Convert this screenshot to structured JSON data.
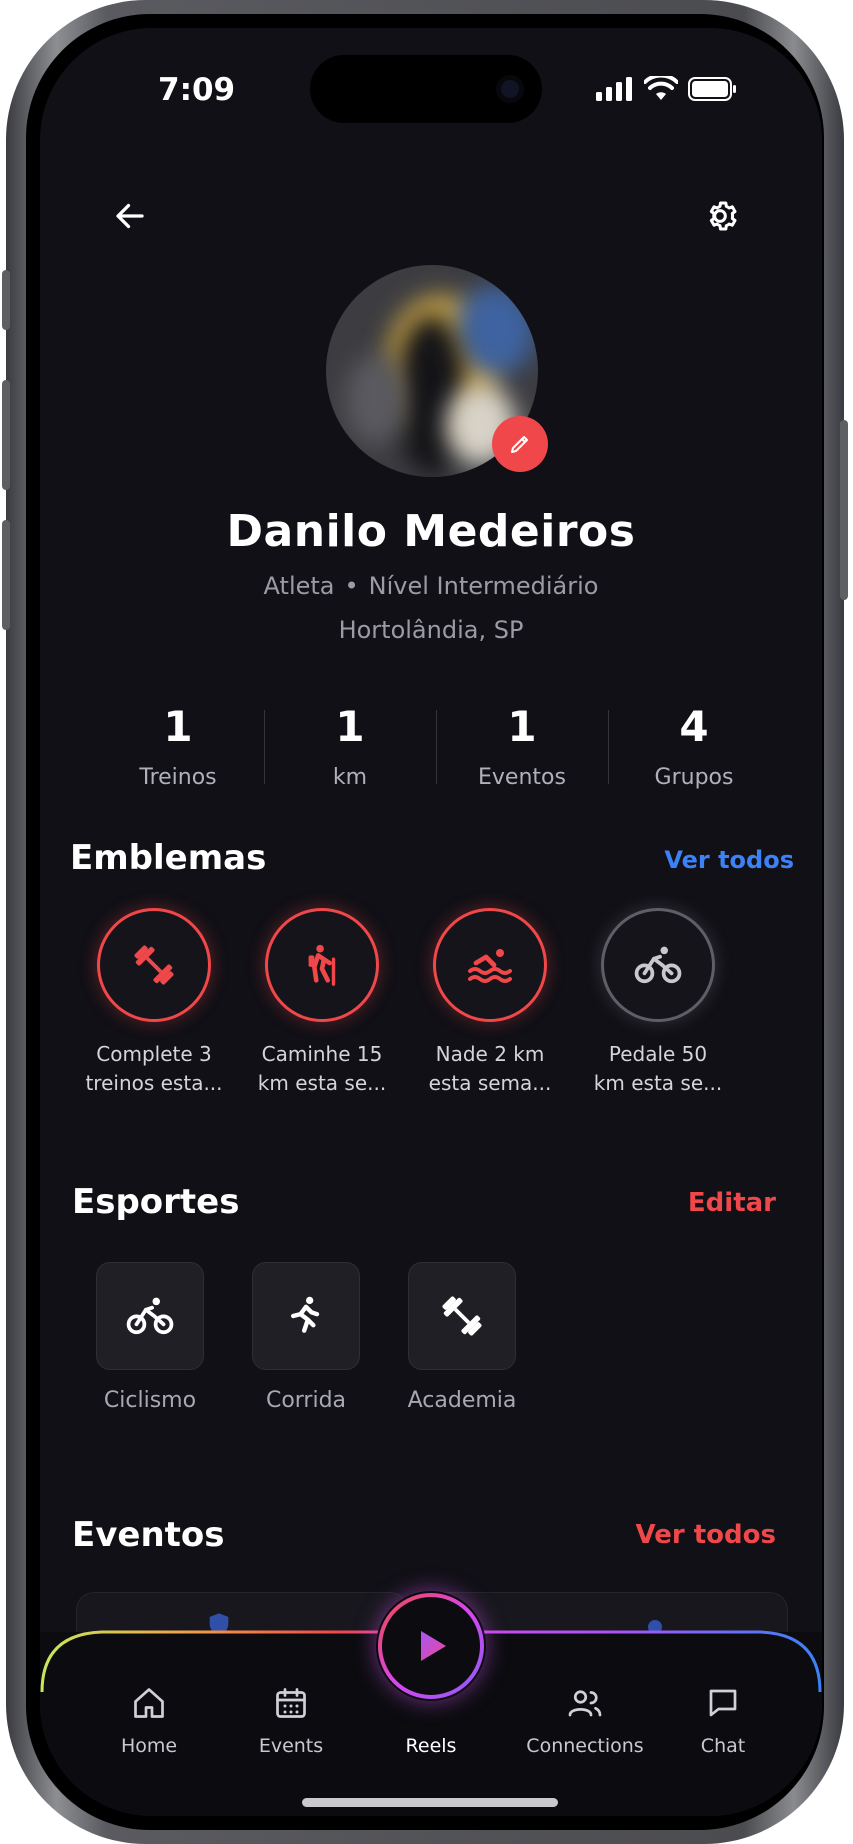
{
  "status_bar": {
    "time": "7:09"
  },
  "profile": {
    "name": "Danilo Medeiros",
    "role": "Atleta",
    "separator": "•",
    "level": "Nível Intermediário",
    "location": "Hortolândia, SP"
  },
  "stats": [
    {
      "value": "1",
      "label": "Treinos"
    },
    {
      "value": "1",
      "label": "km"
    },
    {
      "value": "1",
      "label": "Eventos"
    },
    {
      "value": "4",
      "label": "Grupos"
    }
  ],
  "badges": {
    "title": "Emblemas",
    "link": "Ver todos",
    "items": [
      {
        "icon": "dumbbell-icon",
        "label": "Complete 3\ntreinos esta...",
        "earned": true
      },
      {
        "icon": "hiking-icon",
        "label": "Caminhe 15\nkm esta se...",
        "earned": true
      },
      {
        "icon": "swimming-icon",
        "label": "Nade 2 km\nesta sema...",
        "earned": true
      },
      {
        "icon": "cycling-icon",
        "label": "Pedale 50\nkm esta se...",
        "earned": false
      }
    ]
  },
  "sports": {
    "title": "Esportes",
    "link": "Editar",
    "items": [
      {
        "icon": "bicycle-icon",
        "label": "Ciclismo"
      },
      {
        "icon": "running-icon",
        "label": "Corrida"
      },
      {
        "icon": "dumbbell-icon",
        "label": "Academia"
      }
    ]
  },
  "events": {
    "title": "Eventos",
    "link": "Ver todos"
  },
  "nav": {
    "home": "Home",
    "events": "Events",
    "reels": "Reels",
    "connections": "Connections",
    "chat": "Chat"
  },
  "colors": {
    "accent_red": "#f0484a",
    "link_blue": "#3b82f6",
    "background": "#101016"
  }
}
